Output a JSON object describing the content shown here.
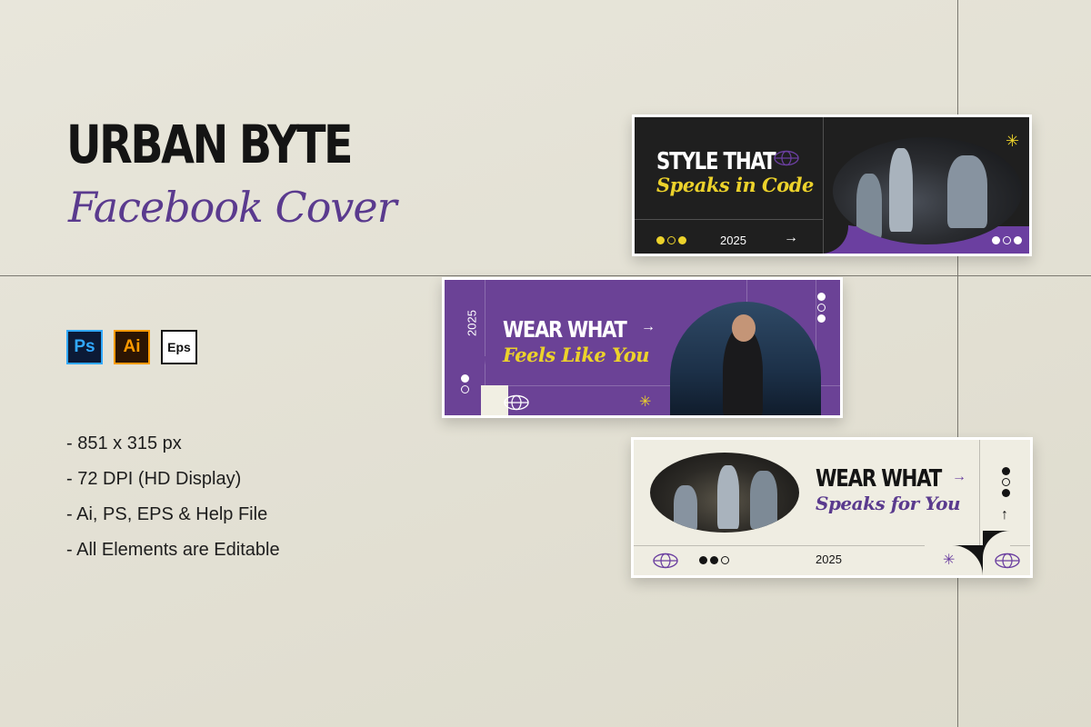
{
  "header": {
    "title": "URBAN BYTE",
    "subtitle": "Facebook Cover"
  },
  "app_icons": [
    {
      "label": "Ps",
      "icon": "photoshop-icon",
      "color": "#31a8ff"
    },
    {
      "label": "Ai",
      "icon": "illustrator-icon",
      "color": "#ff9a00"
    },
    {
      "label": "Eps",
      "icon": "eps-icon",
      "color": "#111111"
    }
  ],
  "features": [
    "- 851 x 315 px",
    "- 72 DPI (HD Display)",
    "- Ai, PS, EPS & Help File",
    "- All Elements are Editable"
  ],
  "cards": {
    "dark": {
      "headline": "STYLE THAT",
      "tagline": "Speaks in Code",
      "year": "2025",
      "arrow": "→",
      "star": "✳"
    },
    "purple": {
      "headline": "WEAR WHAT",
      "tagline": "Feels Like You",
      "year": "2025",
      "arrow": "→",
      "star": "✳"
    },
    "cream": {
      "headline": "WEAR WHAT",
      "tagline": "Speaks for You",
      "year": "2025",
      "arrow": "→",
      "up_arrow": "↑",
      "star": "✳"
    }
  },
  "colors": {
    "accent_purple": "#6b3fa0",
    "accent_yellow": "#ecd22b",
    "dark": "#1f1f1f",
    "cream": "#efede2",
    "background": "#e4e1d5"
  }
}
